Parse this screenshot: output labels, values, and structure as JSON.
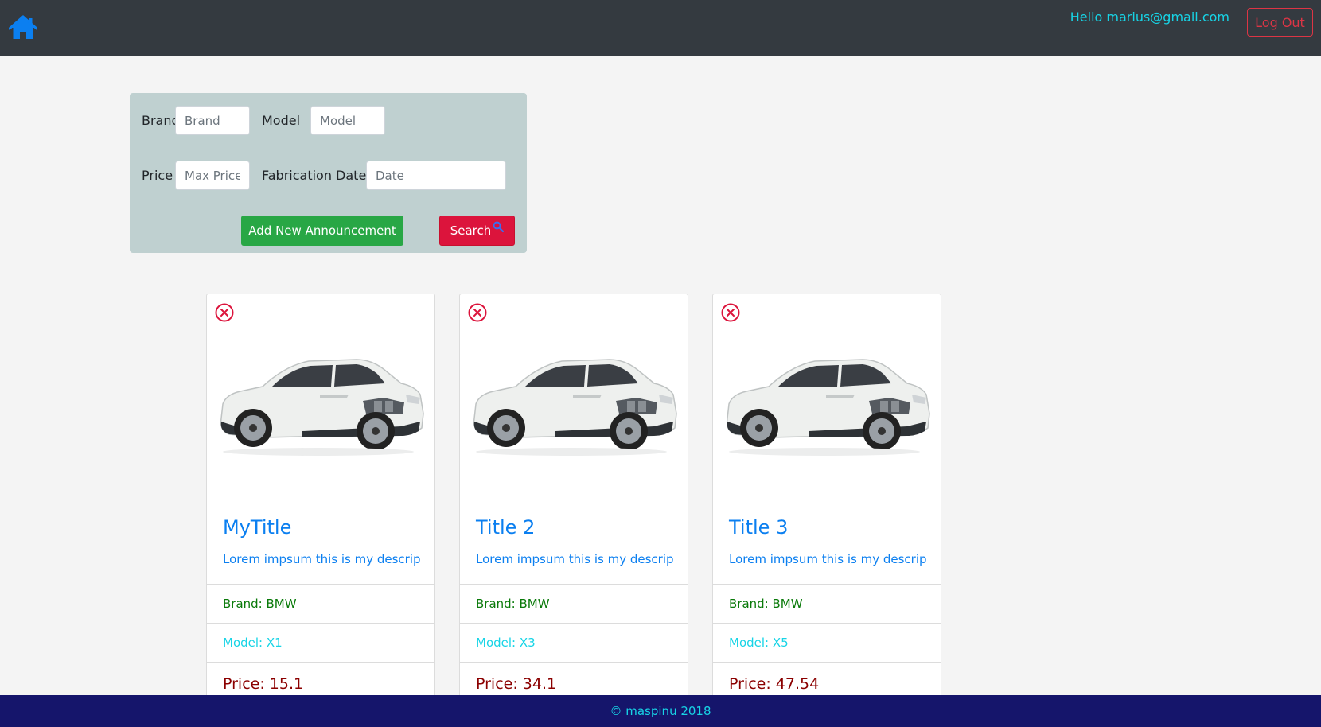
{
  "colors": {
    "navbar_bg": "#343a40",
    "accent_cyan": "#17d4e6",
    "danger": "#dc3545",
    "success": "#28a745",
    "search_red": "#dc143c",
    "panel_bg": "#bfd0d0",
    "footer_bg": "#15156b",
    "link_blue": "#0b7ff0"
  },
  "navbar": {
    "home_icon": "home-icon",
    "greeting": "Hello marius@gmail.com",
    "logout_label": "Log Out"
  },
  "search": {
    "brand_label": "Brand",
    "brand_placeholder": "Brand",
    "model_label": "Model",
    "model_placeholder": "Model",
    "price_label": "Price",
    "price_placeholder": "Max Price",
    "date_label": "Fabrication Date",
    "date_placeholder": "Date",
    "add_label": "Add New Announcement",
    "search_label": "Search",
    "search_icon": "search-icon"
  },
  "cards": [
    {
      "title": "MyTitle",
      "description": "Lorem impsum this is my descrip...",
      "brand": "Brand: BMW",
      "model": "Model: X1",
      "price": "Price: 15.1"
    },
    {
      "title": "Title 2",
      "description": "Lorem impsum this is my descrip...",
      "brand": "Brand: BMW",
      "model": "Model: X3",
      "price": "Price: 34.1"
    },
    {
      "title": "Title 3",
      "description": "Lorem impsum this is my descrip...",
      "brand": "Brand: BMW",
      "model": "Model: X5",
      "price": "Price: 47.54"
    }
  ],
  "footer": {
    "text": "© maspinu 2018"
  }
}
